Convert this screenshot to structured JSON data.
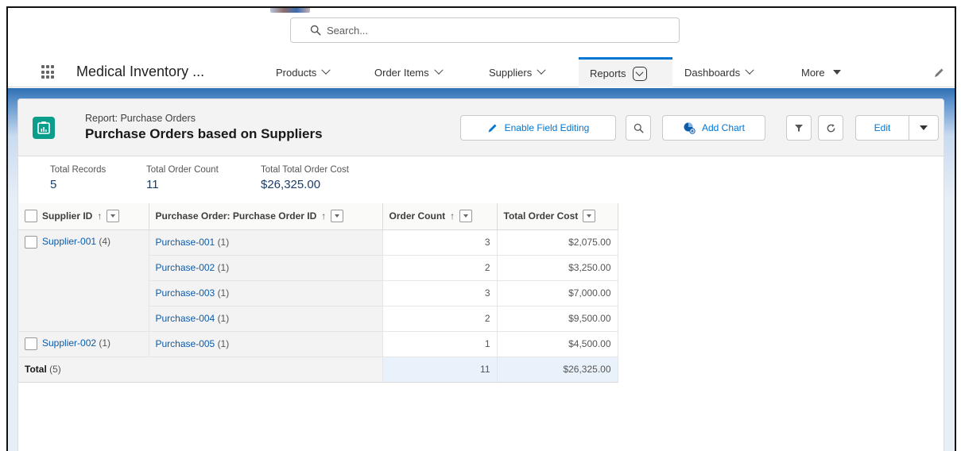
{
  "search": {
    "placeholder": "Search..."
  },
  "nav": {
    "app_name": "Medical Inventory ...",
    "items": [
      {
        "label": "Products"
      },
      {
        "label": "Order Items"
      },
      {
        "label": "Suppliers"
      },
      {
        "label": "Reports"
      },
      {
        "label": "Dashboards"
      },
      {
        "label": "More"
      }
    ]
  },
  "report": {
    "type_label": "Report: Purchase Orders",
    "title": "Purchase Orders based on Suppliers",
    "buttons": {
      "enable_field_editing": "Enable Field Editing",
      "add_chart": "Add Chart",
      "edit": "Edit"
    },
    "summary": [
      {
        "label": "Total Records",
        "value": "5"
      },
      {
        "label": "Total Order Count",
        "value": "11"
      },
      {
        "label": "Total Total Order Cost",
        "value": "$26,325.00"
      }
    ]
  },
  "table": {
    "headers": {
      "supplier_id": "Supplier ID",
      "purchase_order_id": "Purchase Order: Purchase Order ID",
      "order_count": "Order Count",
      "total_order_cost": "Total Order Cost"
    },
    "groups": [
      {
        "supplier": "Supplier-001",
        "supplier_count": "(4)",
        "rows": [
          {
            "po": "Purchase-001",
            "po_count": "(1)",
            "order_count": "3",
            "cost": "$2,075.00"
          },
          {
            "po": "Purchase-002",
            "po_count": "(1)",
            "order_count": "2",
            "cost": "$3,250.00"
          },
          {
            "po": "Purchase-003",
            "po_count": "(1)",
            "order_count": "3",
            "cost": "$7,000.00"
          },
          {
            "po": "Purchase-004",
            "po_count": "(1)",
            "order_count": "2",
            "cost": "$9,500.00"
          }
        ]
      },
      {
        "supplier": "Supplier-002",
        "supplier_count": "(1)",
        "rows": [
          {
            "po": "Purchase-005",
            "po_count": "(1)",
            "order_count": "1",
            "cost": "$4,500.00"
          }
        ]
      }
    ],
    "total": {
      "label": "Total",
      "count": "(5)",
      "order_count": "11",
      "cost": "$26,325.00"
    }
  },
  "colors": {
    "accent": "#0176d3",
    "report_icon": "#0b9e8b",
    "link": "#0b5cab",
    "header_band": "#2f6fb3"
  }
}
